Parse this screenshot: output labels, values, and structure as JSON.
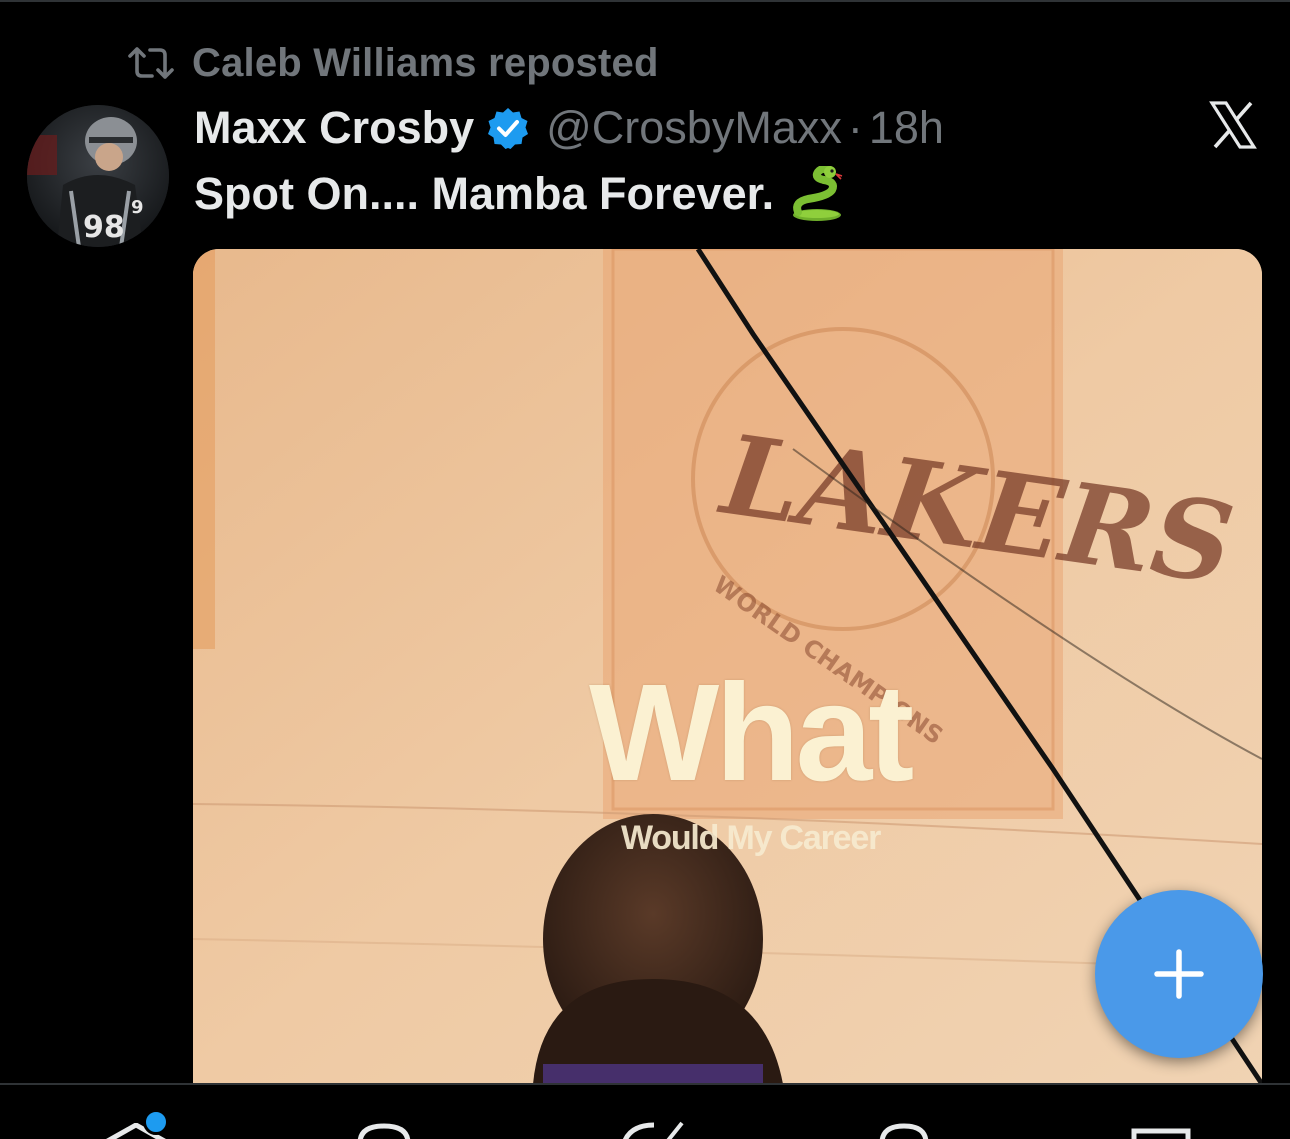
{
  "repost": {
    "icon": "repost-icon",
    "text": "Caleb Williams reposted"
  },
  "tweet": {
    "author": {
      "display_name": "Maxx Crosby",
      "verified": true,
      "verified_icon": "verified-badge-icon",
      "handle": "@CrosbyMaxx",
      "separator": "·",
      "time": "18h",
      "avatar_icon": "avatar"
    },
    "text": "Spot On.... Mamba Forever.",
    "emoji_icon": "snake-emoji-icon",
    "menu_icon": "x-logo-icon",
    "media": {
      "type": "video",
      "overlay_main": "What",
      "overlay_sub": "Would My Career"
    }
  },
  "fab": {
    "icon": "plus-icon"
  },
  "bottom_nav": {
    "items": [
      {
        "name": "home",
        "icon": "home-icon"
      },
      {
        "name": "search",
        "icon": "search-icon"
      },
      {
        "name": "grok",
        "icon": "grok-icon"
      },
      {
        "name": "communities",
        "icon": "communities-icon"
      },
      {
        "name": "messages",
        "icon": "mail-icon"
      }
    ]
  },
  "colors": {
    "background": "#000000",
    "primary_text": "#e7e9ea",
    "secondary_text": "#71767b",
    "accent": "#1d9bf0",
    "fab": "#4a99e9"
  }
}
